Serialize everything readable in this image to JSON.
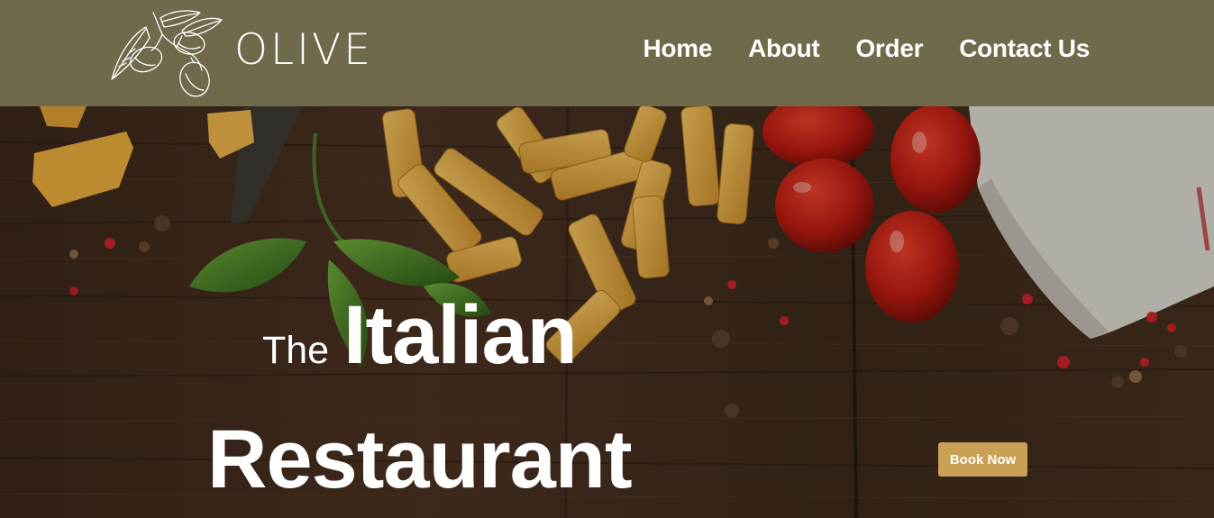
{
  "header": {
    "logo_text": "OLIVE",
    "logo_icon": "olive-branch-icon",
    "background_color": "#6f6a4b"
  },
  "nav": {
    "items": [
      {
        "label": "Home"
      },
      {
        "label": "About"
      },
      {
        "label": "Order"
      },
      {
        "label": "Contact Us"
      }
    ]
  },
  "hero": {
    "headline_the": "The",
    "headline_italian": "Italian",
    "headline_restaurant": "Restaurant",
    "book_label": "Book Now",
    "button_color": "#c9a055"
  }
}
